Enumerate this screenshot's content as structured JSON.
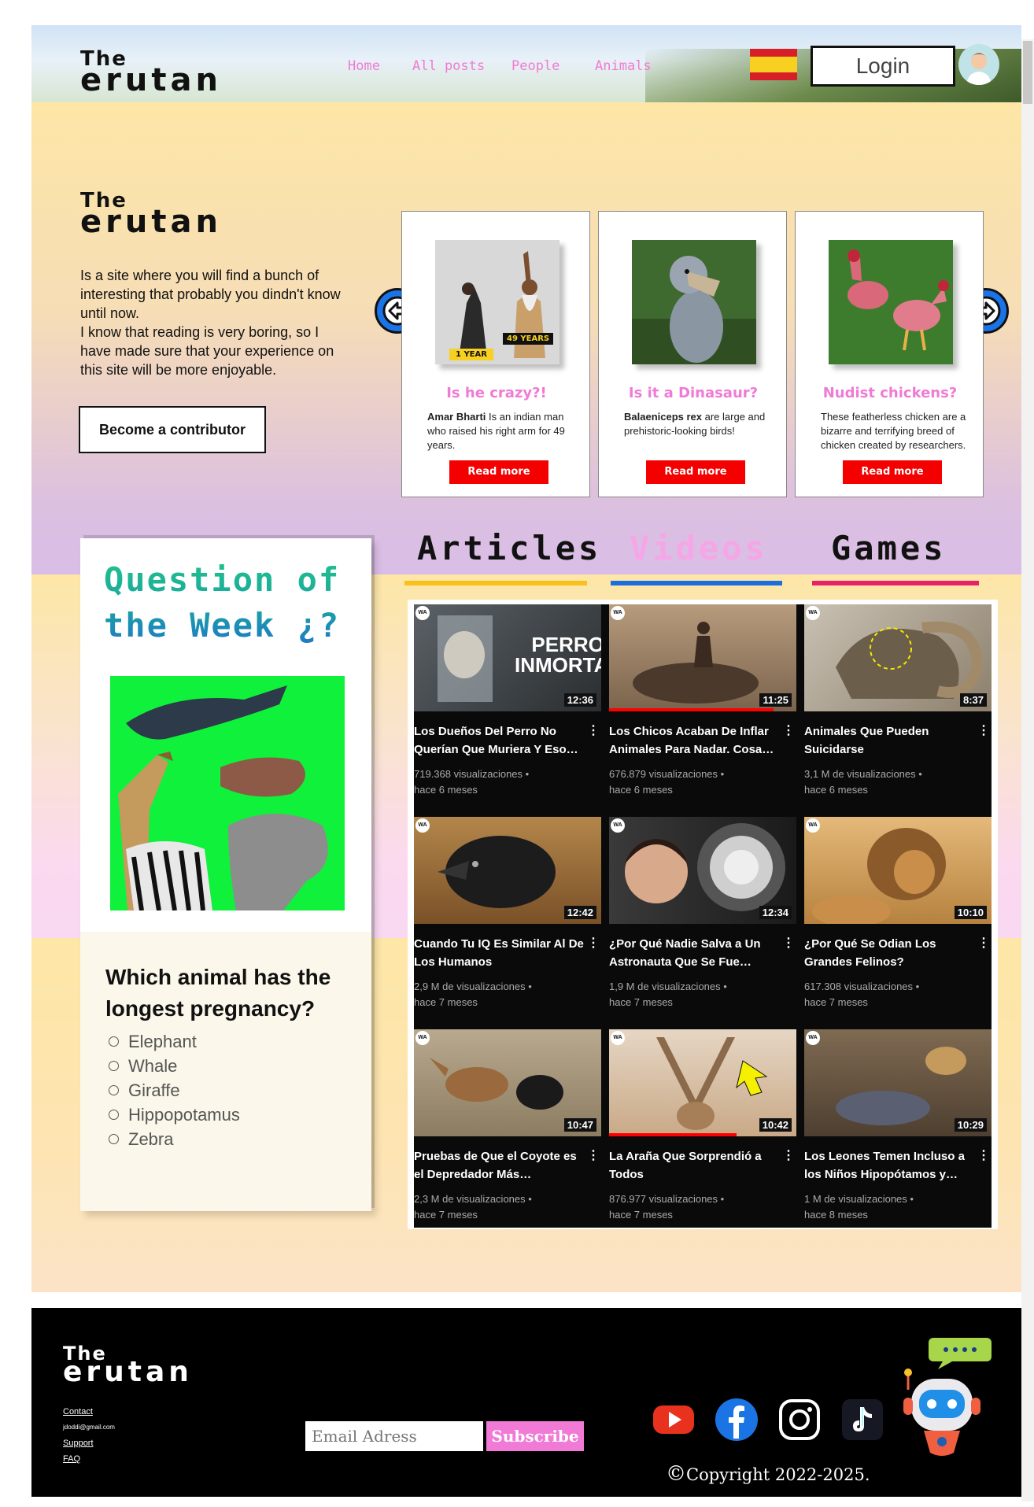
{
  "brand": {
    "line1": "The",
    "line2": "erutan"
  },
  "nav": {
    "home": "Home",
    "all_posts": "All posts",
    "people": "People",
    "animals": "Animals",
    "login": "Login"
  },
  "hero": {
    "intro": "Is a site where you will find a bunch of interesting that probably you dindn't know until now.\nI know that reading is very boring, so I have made sure that your experience on this site will be more enjoyable.",
    "contributor_button": "Become a contributor"
  },
  "cards": [
    {
      "title": "Is he crazy?!",
      "bold": "Amar Bharti",
      "desc": " Is an indian man who raised his right arm for 49 years.",
      "cta": "Read more",
      "badge1": "1 YEAR",
      "badge2": "49 YEARS"
    },
    {
      "title": "Is it a Dinasaur?",
      "bold": "Balaeniceps rex",
      "desc": " are large and prehistoric-looking birds!",
      "cta": "Read more"
    },
    {
      "title": "Nudist chickens?",
      "bold": "",
      "desc": "These featherless chicken are a bizarre and terrifying breed of chicken created by researchers.",
      "cta": "Read more"
    }
  ],
  "question": {
    "title": "Question of the Week ¿?",
    "text": "Which animal has the longest pregnancy?",
    "options": [
      "Elephant",
      "Whale",
      "Giraffe",
      "Hippopotamus",
      "Zebra"
    ]
  },
  "tabs": {
    "articles": "Articles",
    "videos": "Videos",
    "games": "Games"
  },
  "colors": {
    "pink": "#f07ad5",
    "red": "#f40000",
    "yellow": "#f7c21b",
    "blue": "#1b6ee0",
    "magenta": "#e8226a"
  },
  "videos": [
    {
      "title": "Los Dueños Del Perro No Querían Que Muriera Y Eso…",
      "views": "719.368 visualizaciones •",
      "ago": "hace 6 meses",
      "duration": "12:36",
      "overlay": "PERRO INMORTAL",
      "progress": 0
    },
    {
      "title": "Los Chicos Acaban De Inflar Animales Para Nadar. Cosa…",
      "views": "676.879 visualizaciones •",
      "ago": "hace 6 meses",
      "duration": "11:25",
      "progress": 0.88
    },
    {
      "title": "Animales Que Pueden Suicidarse",
      "views": "3,1 M de visualizaciones •",
      "ago": "hace 6 meses",
      "duration": "8:37",
      "progress": 0
    },
    {
      "title": "Cuando Tu IQ Es Similar Al De Los Humanos",
      "views": "2,9 M de visualizaciones •",
      "ago": "hace 7 meses",
      "duration": "12:42",
      "progress": 0
    },
    {
      "title": "¿Por Qué Nadie Salva a Un Astronauta Que Se Fue…",
      "views": "1,9 M de visualizaciones •",
      "ago": "hace 7 meses",
      "duration": "12:34",
      "progress": 0
    },
    {
      "title": "¿Por Qué Se Odian Los Grandes Felinos?",
      "views": "617.308 visualizaciones •",
      "ago": "hace 7 meses",
      "duration": "10:10",
      "progress": 0
    },
    {
      "title": "Pruebas de Que el Coyote es el Depredador Más…",
      "views": "2,3 M de visualizaciones •",
      "ago": "hace 7 meses",
      "duration": "10:47",
      "progress": 0
    },
    {
      "title": "La Araña Que Sorprendió a Todos",
      "views": "876.977 visualizaciones •",
      "ago": "hace 7 meses",
      "duration": "10:42",
      "progress": 0.68
    },
    {
      "title": "Los Leones Temen Incluso a los Niños Hipopótamos y…",
      "views": "1 M de visualizaciones •",
      "ago": "hace 8 meses",
      "duration": "10:29",
      "progress": 0
    }
  ],
  "footer": {
    "contact": "Contact",
    "email": "jdoddi@gmail.com",
    "support": "Support",
    "faq": "FAQ",
    "email_placeholder": "Email Adress",
    "subscribe": "Subscribe",
    "copyright": "Copyright 2022-2025.",
    "copyright_symbol": "©"
  }
}
